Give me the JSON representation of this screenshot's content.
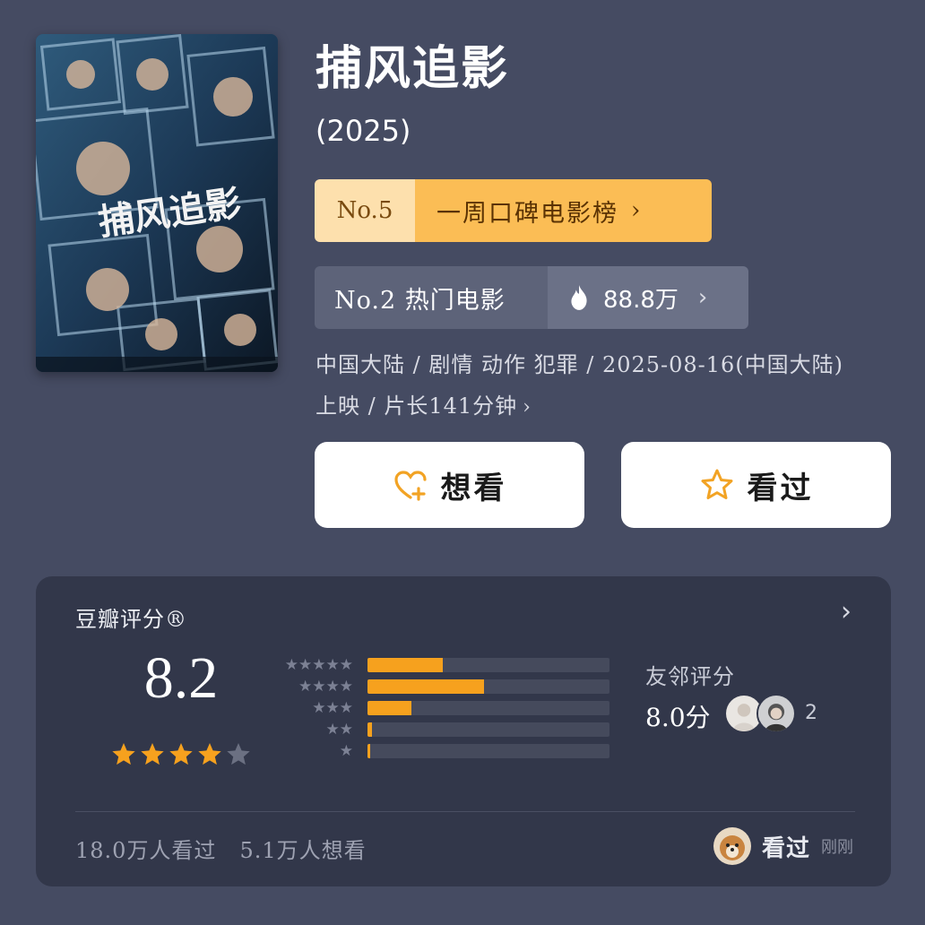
{
  "movie": {
    "title": "捕风追影",
    "year": "(2025)",
    "poster_title": "捕风追影"
  },
  "rank_week": {
    "number": "No.5",
    "label": "一周口碑电影榜",
    "chevron": "›"
  },
  "rank_hot": {
    "label": "No.2 热门电影",
    "heat_icon": "flame-icon",
    "heat_value": "88.8万",
    "chevron": "›"
  },
  "meta": {
    "line1": "中国大陆 / 剧情 动作 犯罪 / 2025-08-16(中国大陆)",
    "line2": "上映 / 片长141分钟",
    "chevron": "›"
  },
  "actions": {
    "want_label": "想看",
    "want_icon": "heart-plus-icon",
    "seen_label": "看过",
    "seen_icon": "star-outline-icon"
  },
  "rating": {
    "header": "豆瓣评分®",
    "score": "8.2",
    "stars_filled": 4,
    "stars_total": 5,
    "distribution": [
      {
        "stars": 5,
        "fraction": 0.31
      },
      {
        "stars": 4,
        "fraction": 0.48
      },
      {
        "stars": 3,
        "fraction": 0.18
      },
      {
        "stars": 2,
        "fraction": 0.02
      },
      {
        "stars": 1,
        "fraction": 0.005
      }
    ],
    "friends_label": "友邻评分",
    "friends_score": "8.0分",
    "friends_count": "2",
    "watched": "18.0万人看过",
    "wanted": "5.1万人想看",
    "recent_action": "看过",
    "recent_time": "刚刚"
  },
  "colors": {
    "background": "#454b62",
    "card": "#32374a",
    "accent_orange": "#f6a11e",
    "rank_gold": "#fbbd55"
  }
}
